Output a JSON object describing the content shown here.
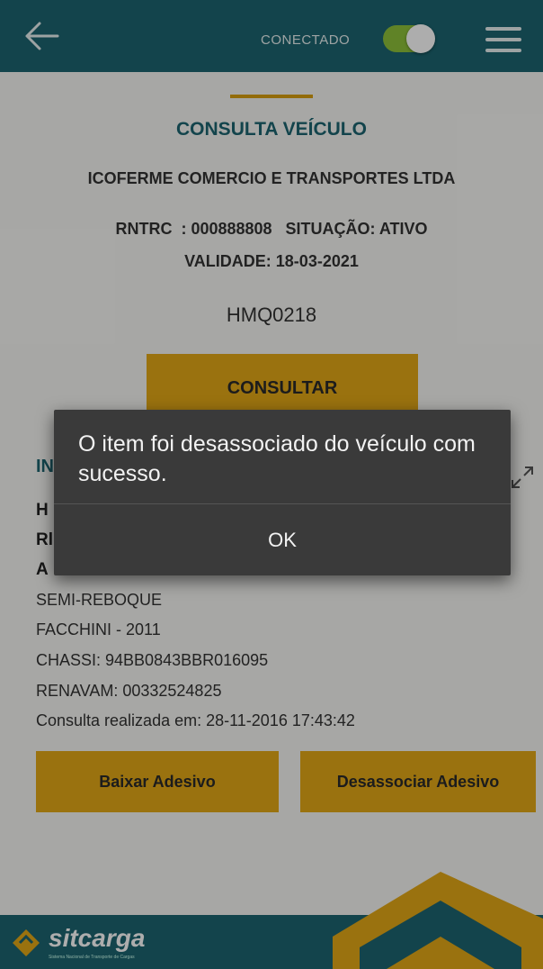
{
  "header": {
    "connection_label": "CONECTADO",
    "connected": true,
    "colors": {
      "bar": "#1c6570",
      "toggle_on": "#8ec23a"
    },
    "icons": [
      "back-arrow-icon",
      "hamburger-menu-icon"
    ]
  },
  "consulta": {
    "title": "CONSULTA VEÍCULO",
    "company": "ICOFERME COMERCIO E TRANSPORTES LTDA",
    "rntrc_line": "RNTRC  : 000888808   SITUAÇÃO: ATIVO",
    "validade": "VALIDADE: 18-03-2021",
    "plate": "HMQ0218",
    "consultar_button": "CONSULTAR"
  },
  "info": {
    "heading_fragment": "IN",
    "line1_fragment": "H",
    "line2_fragment": "Rl",
    "line3_fragment": "A",
    "tipo": "SEMI-REBOQUE",
    "marca_ano": "FACCHINI - 2011",
    "chassi": "CHASSI: 94BB0843BBR016095",
    "renavam": "RENAVAM: 00332524825",
    "consulta_realizada": "Consulta realizada em: 28-11-2016 17:43:42"
  },
  "actions": {
    "baixar": "Baixar Adesivo",
    "desassociar": "Desassociar Adesivo"
  },
  "footer": {
    "logo_text": "sitcarga",
    "logo_subtitle": "Sistema Nacional de Transporte de Cargas"
  },
  "dialog": {
    "message": "O item foi desassociado do veículo com sucesso.",
    "ok_label": "OK"
  },
  "accent_color": "#e3a817"
}
